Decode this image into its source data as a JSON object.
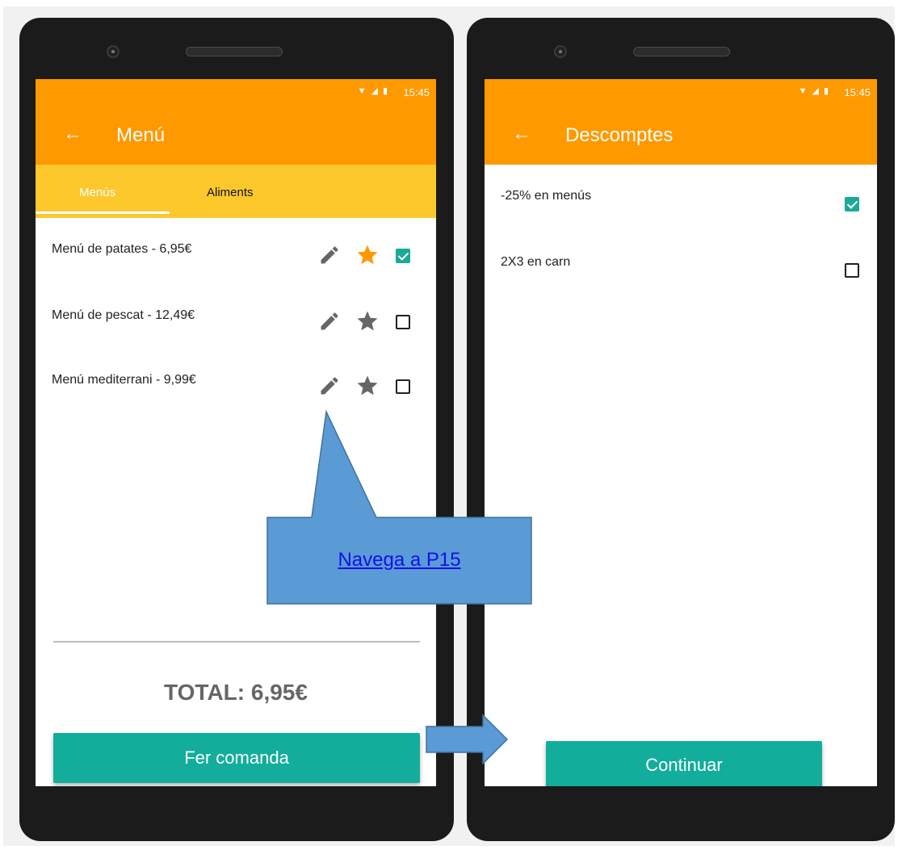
{
  "left_phone": {
    "status_time": "15:45",
    "title": "Menú",
    "tabs": [
      {
        "label": "Menús",
        "active": true
      },
      {
        "label": "Aliments",
        "active": false
      }
    ],
    "items": [
      {
        "label": "Menú de patates - 6,95€",
        "starred": true,
        "checked": true
      },
      {
        "label": "Menú de pescat - 12,49€",
        "starred": false,
        "checked": false
      },
      {
        "label": "Menú mediterrani - 9,99€",
        "starred": false,
        "checked": false
      }
    ],
    "total": "TOTAL: 6,95€",
    "button_label": "Fer comanda"
  },
  "right_phone": {
    "status_time": "15:45",
    "title": "Descomptes",
    "items": [
      {
        "label": "-25% en menús",
        "checked": true
      },
      {
        "label": "2X3 en carn",
        "checked": false
      }
    ],
    "button_label": "Continuar"
  },
  "callout": {
    "text": "Navega a P15"
  },
  "colors": {
    "appbar": "#ff9900",
    "tabs": "#fcc82c",
    "accent": "#13ad9b",
    "star_active": "#ff9900",
    "icon_grey": "#666666",
    "callout_fill": "#5b9bd5",
    "callout_stroke": "#41719c"
  }
}
